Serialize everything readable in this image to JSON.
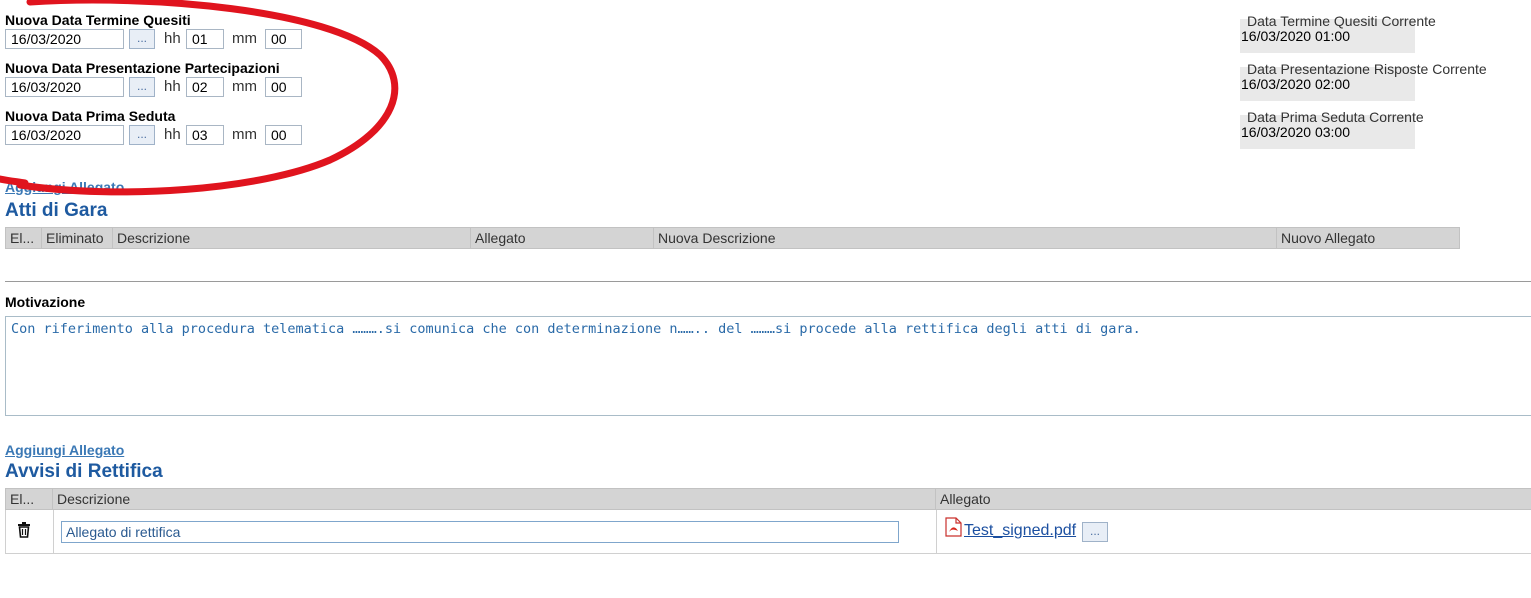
{
  "dates": [
    {
      "label": "Nuova Data Termine Quesiti",
      "date": "16/03/2020",
      "hh": "01",
      "mm": "00"
    },
    {
      "label": "Nuova Data Presentazione Partecipazioni",
      "date": "16/03/2020",
      "hh": "02",
      "mm": "00"
    },
    {
      "label": "Nuova Data Prima Seduta",
      "date": "16/03/2020",
      "hh": "03",
      "mm": "00"
    }
  ],
  "picker_label": "...",
  "hh_label": "hh",
  "mm_label": "mm",
  "current": [
    {
      "label": "Data Termine Quesiti Corrente",
      "value": "16/03/2020 01:00"
    },
    {
      "label": "Data Presentazione Risposte Corrente",
      "value": "16/03/2020 02:00"
    },
    {
      "label": "Data Prima Seduta Corrente",
      "value": "16/03/2020 03:00"
    }
  ],
  "atti": {
    "add_link": "Aggiungi Allegato",
    "title": "Atti di Gara",
    "columns": [
      "El...",
      "Eliminato",
      "Descrizione",
      "Allegato",
      "Nuova Descrizione",
      "Nuovo Allegato"
    ]
  },
  "motivazione": {
    "label": "Motivazione",
    "text": "Con riferimento alla procedura telematica ……….si comunica che con determinazione n…….. del ………si procede alla rettifica degli atti di gara."
  },
  "avvisi": {
    "add_link": "Aggiungi Allegato",
    "title": "Avvisi di Rettifica",
    "columns": [
      "El...",
      "Descrizione",
      "Allegato"
    ],
    "row": {
      "descrizione": "Allegato di rettifica",
      "file": "Test_signed.pdf"
    }
  },
  "annotation_color": "#e0141e"
}
